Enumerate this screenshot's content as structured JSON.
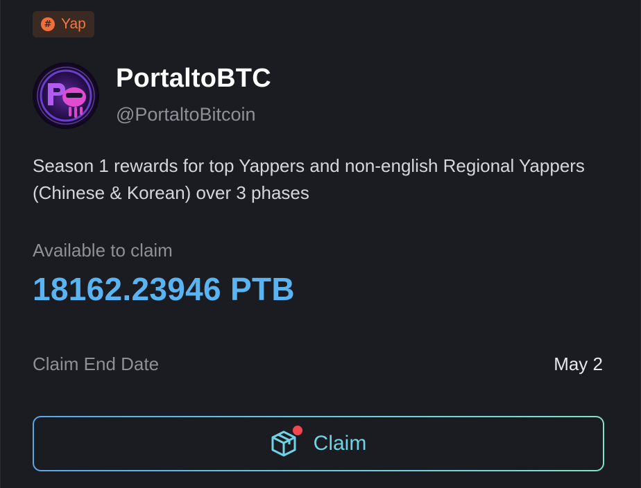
{
  "tag": {
    "label": "Yap",
    "icon": "hashtag-icon",
    "color": "#f07a45"
  },
  "project": {
    "name": "PortaltoBTC",
    "handle": "@PortaltoBitcoin",
    "description": "Season 1 rewards for top Yappers and non-english Regional Yappers (Chinese & Korean) over 3 phases"
  },
  "claim_info": {
    "available_label": "Available to claim",
    "amount": "18162.23946 PTB",
    "end_date_label": "Claim End Date",
    "end_date_value": "May 2"
  },
  "claim_button": {
    "label": "Claim",
    "icon": "package-box-icon",
    "has_notification": true
  },
  "colors": {
    "background": "#1b1c21",
    "accent_blue": "#5ab4f2",
    "button_text": "#6fd3e6",
    "notification": "#f0484e"
  }
}
